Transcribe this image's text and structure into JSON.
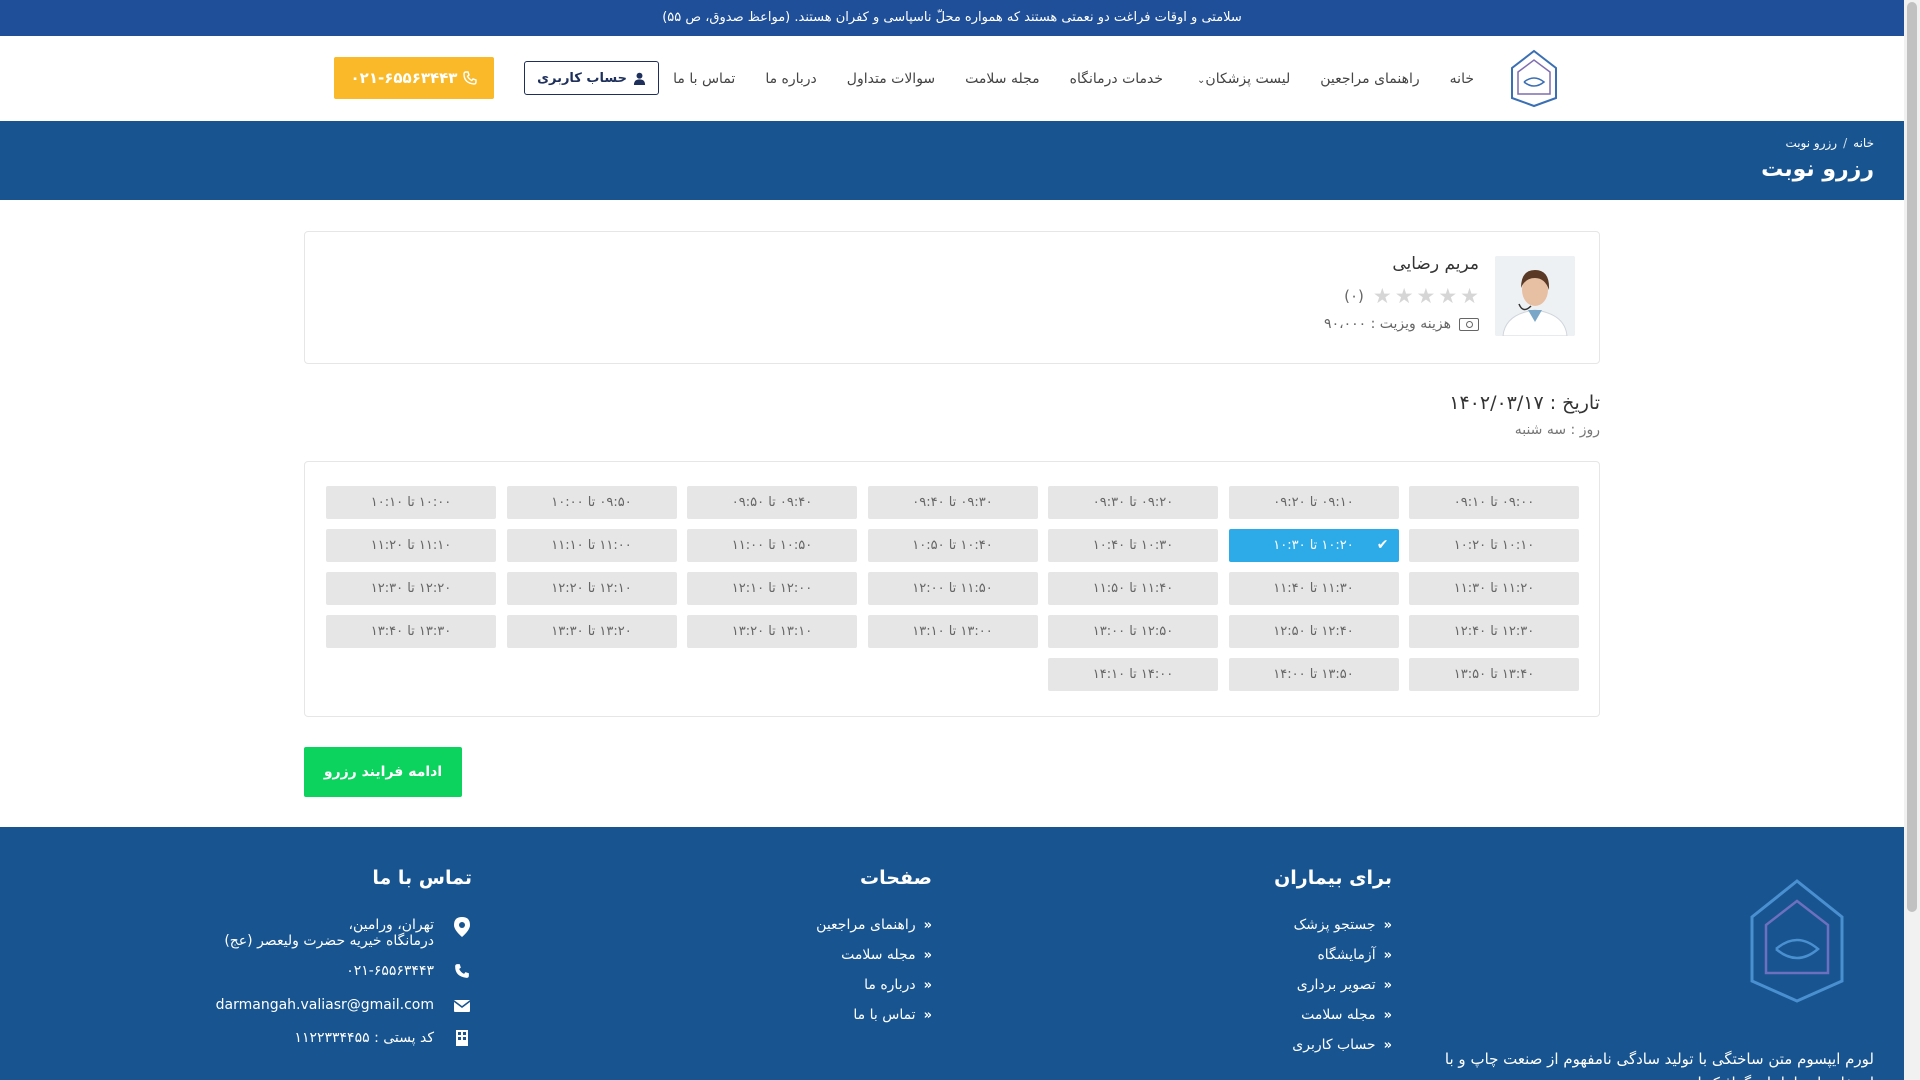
{
  "announcement": "سلامتی و اوقات فراغت دو نعمتی هستند که همواره محلّ ناسپاسی و کفران هستند. (مواعظ صدوق، ص ۵۵)",
  "nav": {
    "items": [
      "خانه",
      "راهنمای مراجعین",
      "لیست پزشکان",
      "خدمات درمانگاه",
      "مجله سلامت",
      "سوالات متداول",
      "درباره ما",
      "تماس با ما"
    ],
    "account_label": "حساب کاربری",
    "phone_label": "۰۲۱-۶۵۵۶۳۴۴۳"
  },
  "breadcrumb": {
    "home": "خانه",
    "current": "رزرو نوبت"
  },
  "page_title": "رزرو نوبت",
  "doctor": {
    "name": "مریم رضایی",
    "rating_count": "(۰)",
    "fee_label": "هزینه ویزیت : ۹۰،۰۰۰"
  },
  "booking": {
    "date_label": "تاریخ : ۱۴۰۲/۰۳/۱۷",
    "day_label": "روز : سه شنبه",
    "selected_index": 8,
    "slots": [
      "۰۹:۰۰ تا ۰۹:۱۰",
      "۰۹:۱۰ تا ۰۹:۲۰",
      "۰۹:۲۰ تا ۰۹:۳۰",
      "۰۹:۳۰ تا ۰۹:۴۰",
      "۰۹:۴۰ تا ۰۹:۵۰",
      "۰۹:۵۰ تا ۱۰:۰۰",
      "۱۰:۰۰ تا ۱۰:۱۰",
      "۱۰:۱۰ تا ۱۰:۲۰",
      "۱۰:۲۰ تا ۱۰:۳۰",
      "۱۰:۳۰ تا ۱۰:۴۰",
      "۱۰:۴۰ تا ۱۰:۵۰",
      "۱۰:۵۰ تا ۱۱:۰۰",
      "۱۱:۰۰ تا ۱۱:۱۰",
      "۱۱:۱۰ تا ۱۱:۲۰",
      "۱۱:۲۰ تا ۱۱:۳۰",
      "۱۱:۳۰ تا ۱۱:۴۰",
      "۱۱:۴۰ تا ۱۱:۵۰",
      "۱۱:۵۰ تا ۱۲:۰۰",
      "۱۲:۰۰ تا ۱۲:۱۰",
      "۱۲:۱۰ تا ۱۲:۲۰",
      "۱۲:۲۰ تا ۱۲:۳۰",
      "۱۲:۳۰ تا ۱۲:۴۰",
      "۱۲:۴۰ تا ۱۲:۵۰",
      "۱۲:۵۰ تا ۱۳:۰۰",
      "۱۳:۰۰ تا ۱۳:۱۰",
      "۱۳:۱۰ تا ۱۳:۲۰",
      "۱۳:۲۰ تا ۱۳:۳۰",
      "۱۳:۳۰ تا ۱۳:۴۰",
      "۱۳:۴۰ تا ۱۳:۵۰",
      "۱۳:۵۰ تا ۱۴:۰۰",
      "۱۴:۰۰ تا ۱۴:۱۰"
    ],
    "continue_label": "ادامه فرایند رزرو"
  },
  "footer": {
    "patients_title": "برای بیماران",
    "patients_links": [
      "جستجو پزشک",
      "آزمایشگاه",
      "تصویر برداری",
      "مجله سلامت",
      "حساب کاربری"
    ],
    "pages_title": "صفحات",
    "pages_links": [
      "راهنمای مراجعین",
      "مجله سلامت",
      "درباره ما",
      "تماس با ما"
    ],
    "contact_title": "تماس با ما",
    "address_line1": "تهران، ورامین،",
    "address_line2": "درمانگاه خیریه حضرت ولیعصر (عج)",
    "phone": "۰۲۱-۶۵۵۶۳۴۴۳",
    "email": "darmangah.valiasr@gmail.com",
    "postal": "کد پستی : ۱۱۲۲۳۳۴۴۵۵",
    "lorem": "لورم ایپسوم متن ساختگی با تولید سادگی نامفهوم از صنعت چاپ و با استفاده از طراحان گرافیک است"
  },
  "colors": {
    "primary": "#175490",
    "topbar": "#1f4f98",
    "accent": "#f9b928",
    "selected": "#2dabe8",
    "continue": "#0cd35d"
  }
}
